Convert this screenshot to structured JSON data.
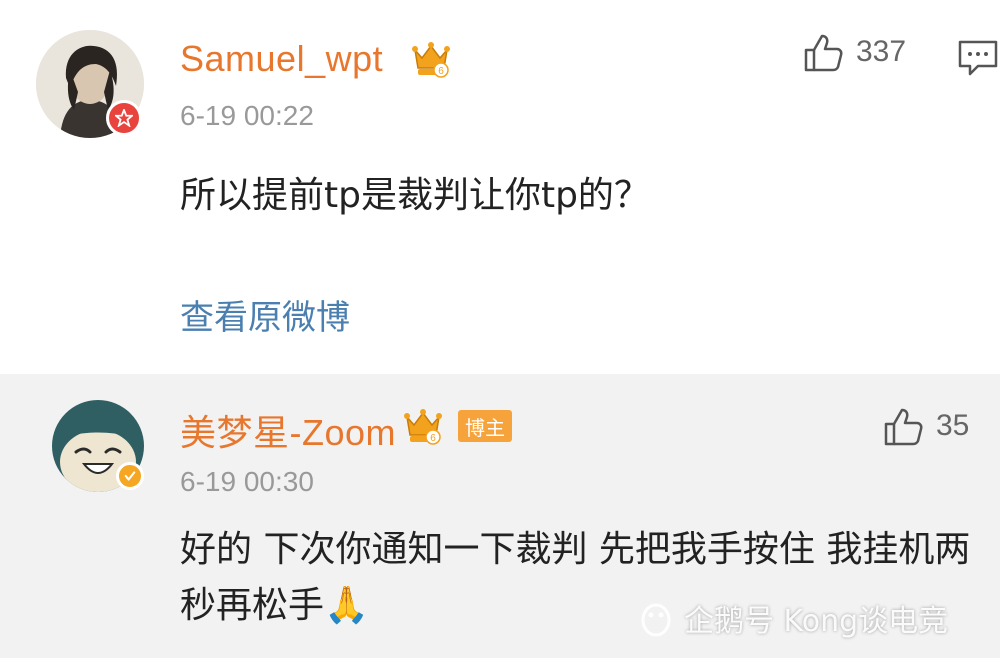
{
  "comments": [
    {
      "username": "Samuel_wpt",
      "timestamp": "6-19 00:22",
      "text": "所以提前tp是裁判让你tp的？",
      "likes": "337",
      "view_link": "查看原微博",
      "vip_level": "6"
    },
    {
      "username": "美梦星-Zoom",
      "timestamp": "6-19 00:30",
      "text": "好的 下次你通知一下裁判 先把我手按住 我挂机两秒再松手🙏",
      "likes": "35",
      "vip_level": "6",
      "tag": "博主"
    }
  ],
  "watermark": "企鹅号 Kong谈电竞",
  "colors": {
    "username": "#e8772e",
    "link": "#4a7fb0",
    "timestamp": "#999999",
    "tag_bg": "#f5a33a",
    "reply_bg": "#f2f2f2"
  },
  "icons": [
    "thumbs-up-icon",
    "reply-icon",
    "vip-crown-icon",
    "verified-badge-icon"
  ]
}
